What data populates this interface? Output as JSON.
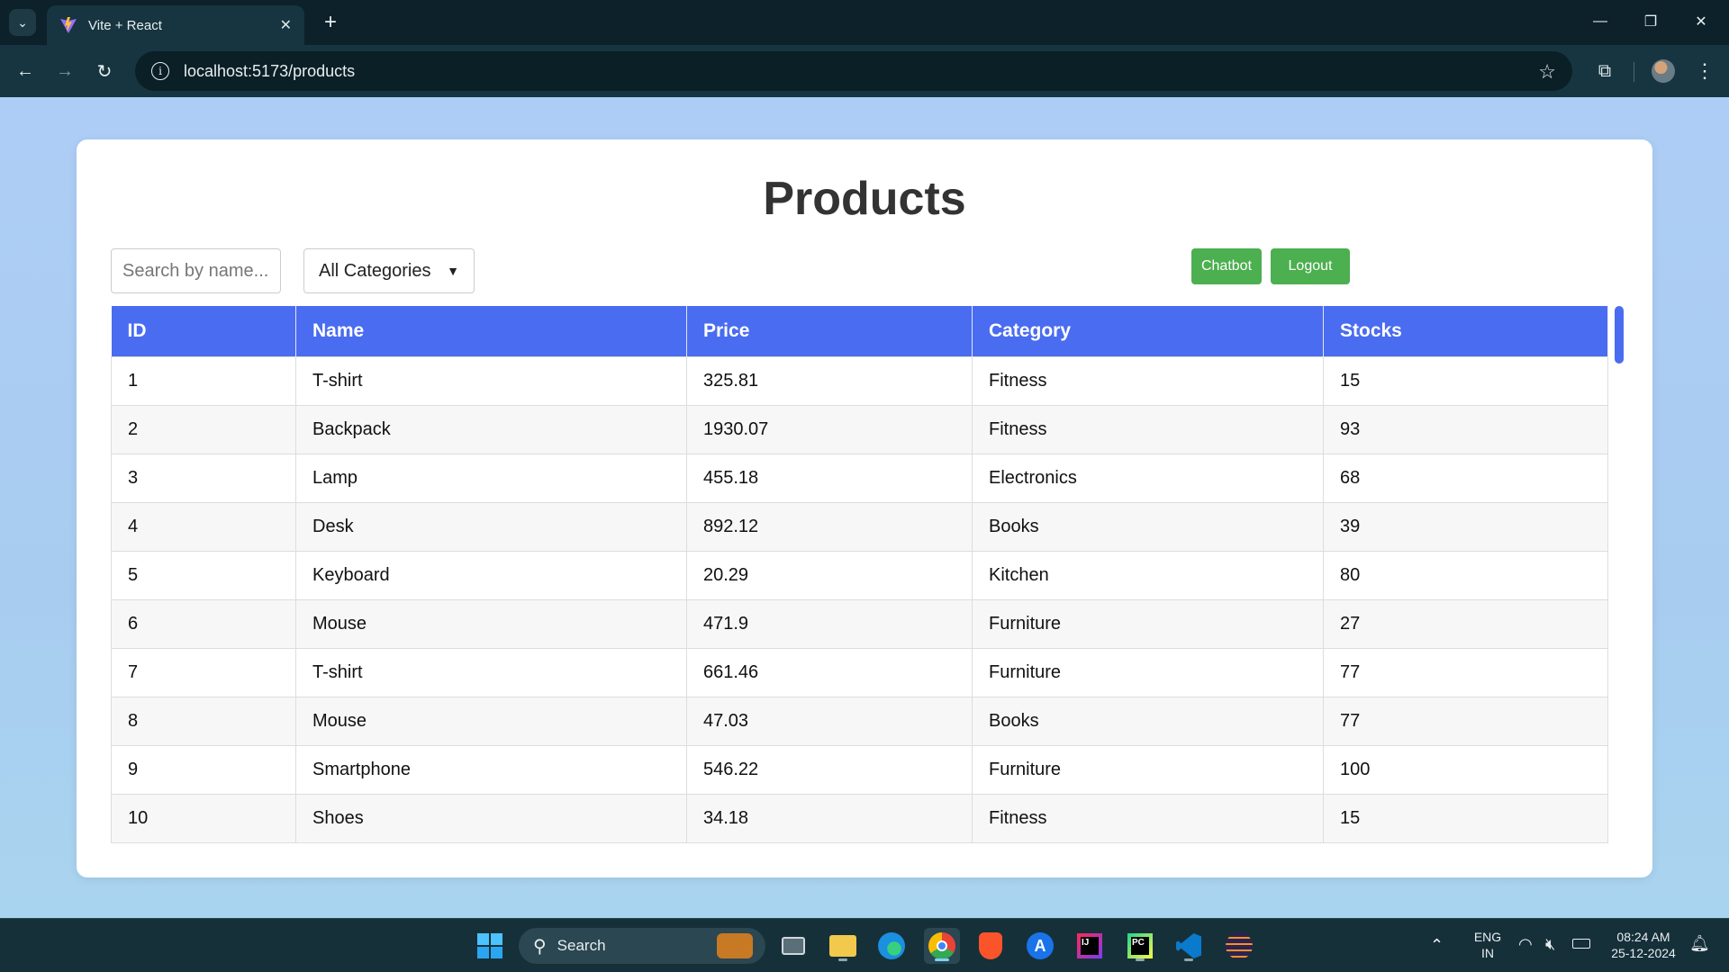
{
  "browser": {
    "tab_title": "Vite + React",
    "url": "localhost:5173/products"
  },
  "page": {
    "title": "Products",
    "search_placeholder": "Search by name...",
    "category_selected": "All Categories",
    "chatbot_label": "Chatbot",
    "logout_label": "Logout"
  },
  "table": {
    "headers": [
      "ID",
      "Name",
      "Price",
      "Category",
      "Stocks"
    ],
    "rows": [
      [
        "1",
        "T-shirt",
        "325.81",
        "Fitness",
        "15"
      ],
      [
        "2",
        "Backpack",
        "1930.07",
        "Fitness",
        "93"
      ],
      [
        "3",
        "Lamp",
        "455.18",
        "Electronics",
        "68"
      ],
      [
        "4",
        "Desk",
        "892.12",
        "Books",
        "39"
      ],
      [
        "5",
        "Keyboard",
        "20.29",
        "Kitchen",
        "80"
      ],
      [
        "6",
        "Mouse",
        "471.9",
        "Furniture",
        "27"
      ],
      [
        "7",
        "T-shirt",
        "661.46",
        "Furniture",
        "77"
      ],
      [
        "8",
        "Mouse",
        "47.03",
        "Books",
        "77"
      ],
      [
        "9",
        "Smartphone",
        "546.22",
        "Furniture",
        "100"
      ],
      [
        "10",
        "Shoes",
        "34.18",
        "Fitness",
        "15"
      ]
    ]
  },
  "taskbar": {
    "search_label": "Search",
    "lang": "ENG",
    "region": "IN",
    "time": "08:24 AM",
    "date": "25-12-2024"
  },
  "colors": {
    "header_blue": "#4a6cf0",
    "button_green": "#4caf50"
  }
}
